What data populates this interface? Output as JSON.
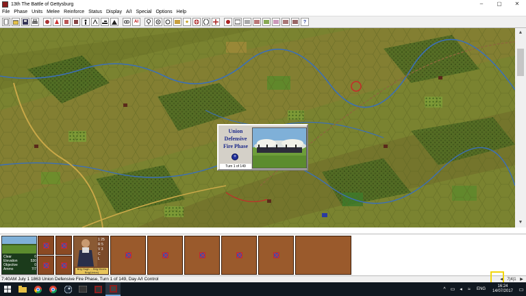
{
  "window": {
    "title": "13th The Battle of Gettysburg",
    "minimize": "–",
    "maximize": "▢",
    "close": "✕"
  },
  "menu": [
    "File",
    "Phase",
    "Units",
    "Melee",
    "Reinforce",
    "Status",
    "Display",
    "A/I",
    "Special",
    "Options",
    "Help"
  ],
  "toolbar": {
    "icons": [
      "new-icon",
      "open-icon",
      "save-icon",
      "print-icon",
      "unit-icon",
      "fire-icon",
      "leader-icon",
      "chair-icon",
      "man-icon",
      "march-icon",
      "artillery-icon",
      "tent-icon",
      "eye-icon",
      "ai-icon",
      "balloon-icon",
      "target-icon",
      "wagon-icon",
      "flag-icon",
      "star-icon",
      "cross-icon",
      "hex-icon",
      "move-icon",
      "diamond-icon",
      "arrow-icon",
      "anchor-icon",
      "camera-icon",
      "binoculars-icon",
      "counter-icon",
      "map-icon",
      "flag2-icon",
      "info-icon",
      "help-icon"
    ],
    "ai_label": "AI",
    "help_label": "?"
  },
  "phase_dialog": {
    "title_line1": "Union",
    "title_line2": "Defensive",
    "title_line3": "Fire Phase",
    "turn_text": "Turn  1  of 149",
    "ok_glyph": "+"
  },
  "terrain": {
    "rows": [
      {
        "label": "Clear",
        "value": "0"
      },
      {
        "label": "Elevation",
        "value": "530"
      },
      {
        "label": "Objective",
        "value": "0"
      },
      {
        "label": "Ammo",
        "value": "7/7"
      }
    ]
  },
  "leader": {
    "stats": [
      "1 25",
      "R 5",
      "V 3",
      "C",
      "L"
    ],
    "name": "Brig Hugh ... Brig Morris Brig(Union)"
  },
  "status": {
    "text": "7:40AM July 1 1863 Union Defensive Fire Phase, Turn 1 of 149, Day A/I Control",
    "left_arrow": "◀",
    "right_arrow": "▶",
    "corner": "7|4|1"
  },
  "taskbar": {
    "apps": [
      "file-explorer-icon",
      "chrome-icon",
      "chrome-icon-2",
      "steam-icon",
      "cmd-icon",
      "game-icon",
      "game-active-icon"
    ],
    "lang": "ENG",
    "time": "16:24",
    "date": "14/07/2017",
    "notification": "▭"
  }
}
